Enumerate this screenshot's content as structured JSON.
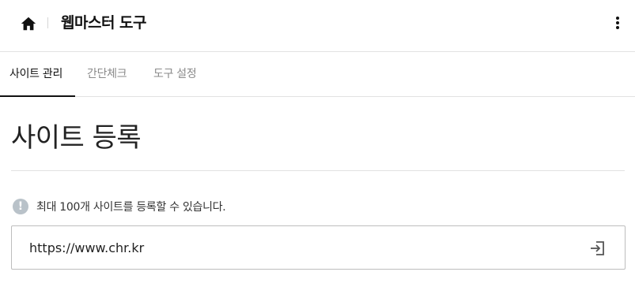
{
  "header": {
    "home_icon": "home-icon",
    "title": "웹마스터 도구",
    "more_icon": "more-vertical-icon"
  },
  "tabs": [
    {
      "label": "사이트 관리",
      "active": true
    },
    {
      "label": "간단체크",
      "active": false
    },
    {
      "label": "도구 설정",
      "active": false
    }
  ],
  "main": {
    "page_title": "사이트 등록",
    "info_icon": "exclamation-circle-icon",
    "info_text": "최대 100개 사이트를 등록할 수 있습니다.",
    "url_input": {
      "value": "https://www.chr.kr",
      "placeholder": ""
    },
    "submit_icon": "enter-arrow-icon"
  },
  "colors": {
    "active_tab": "#111111",
    "inactive_tab": "#8a8a8a",
    "info_icon_bg": "#b9c2c9",
    "divider": "#e2e2e2",
    "input_border": "#bdbdbd"
  }
}
